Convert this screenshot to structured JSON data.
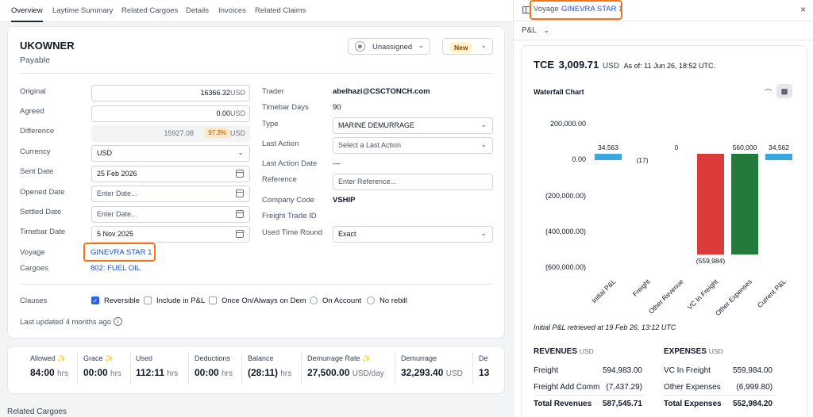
{
  "tabs": [
    "Overview",
    "Laytime Summary",
    "Related Cargoes",
    "Details",
    "Invoices",
    "Related Claims"
  ],
  "header": {
    "title": "UKOWNER",
    "subtitle": "Payable",
    "assignee": "Unassigned",
    "status": "New"
  },
  "form_left": {
    "original_label": "Original",
    "original_value": "16366.32",
    "original_unit": "USD",
    "agreed_label": "Agreed",
    "agreed_value": "0.00",
    "agreed_unit": "USD",
    "difference_label": "Difference",
    "difference_value": "15927.08",
    "difference_pct": "97.3%",
    "difference_unit": "USD",
    "currency_label": "Currency",
    "currency_value": "USD",
    "sent_date_label": "Sent Date",
    "sent_date_value": "25 Feb 2026",
    "opened_date_label": "Opened Date",
    "opened_date_placeholder": "Enter Date...",
    "settled_date_label": "Settled Date",
    "settled_date_placeholder": "Enter Date...",
    "timebar_date_label": "Timebar Date",
    "timebar_date_value": "5 Nov 2025",
    "voyage_label": "Voyage",
    "voyage_value": "GINEVRA STAR 1",
    "cargoes_label": "Cargoes",
    "cargoes_value": "802: FUEL OIL"
  },
  "form_right": {
    "trader_label": "Trader",
    "trader_value": "abelhazi@CSCTONCH.com",
    "timebar_days_label": "Timebar Days",
    "timebar_days_value": "90",
    "type_label": "Type",
    "type_value": "MARINE DEMURRAGE",
    "last_action_label": "Last Action",
    "last_action_placeholder": "Select a Last Action",
    "last_action_date_label": "Last Action Date",
    "last_action_date_value": "—",
    "reference_label": "Reference",
    "reference_placeholder": "Enter Reference...",
    "company_code_label": "Company Code",
    "company_code_value": "VSHIP",
    "freight_trade_id_label": "Freight Trade ID",
    "used_time_round_label": "Used Time Round",
    "used_time_round_value": "Exact"
  },
  "clauses": {
    "label": "Clauses",
    "items": [
      "Reversible",
      "Include in P&L",
      "Once On/Always on Dem",
      "On Account",
      "No rebill"
    ],
    "last_updated": "Last updated 4 months ago"
  },
  "metrics": [
    {
      "label": "Allowed",
      "value": "84:00",
      "unit": "hrs",
      "icon": true
    },
    {
      "label": "Grace",
      "value": "00:00",
      "unit": "hrs",
      "icon": true
    },
    {
      "label": "Used",
      "value": "112:11",
      "unit": "hrs",
      "icon": false
    },
    {
      "label": "Deductions",
      "value": "00:00",
      "unit": "hrs",
      "icon": false
    },
    {
      "label": "Balance",
      "value": "(28:11)",
      "unit": "hrs",
      "icon": false
    },
    {
      "label": "Demurrage Rate",
      "value": "27,500.00",
      "unit": "USD/day",
      "icon": true
    },
    {
      "label": "Demurrage",
      "value": "32,293.40",
      "unit": "USD",
      "icon": false
    },
    {
      "label": "De",
      "value": "13",
      "unit": "",
      "icon": false
    }
  ],
  "related_cargoes_heading": "Related Cargoes",
  "right_panel": {
    "voyage_prefix": "Voyage",
    "voyage_name": "GINEVRA STAR 1",
    "pl_dropdown": "P&L",
    "tce_label": "TCE",
    "tce_value": "3,009.71",
    "tce_unit": "USD",
    "as_of": "As of: 11 Jun 26, 18:52 UTC.",
    "chart_title": "Waterfall Chart",
    "retrieved_note": "Initial P&L retrieved at 19 Feb 26, 13:12 UTC",
    "revenues_title": "REVENUES",
    "revenues_unit": "USD",
    "revenues": [
      {
        "label": "Freight",
        "value": "594,983.00"
      },
      {
        "label": "Freight Add Comm",
        "value": "(7,437.29)"
      }
    ],
    "total_revenues_label": "Total Revenues",
    "total_revenues_value": "587,545.71",
    "expenses_title": "EXPENSES",
    "expenses_unit": "USD",
    "expenses": [
      {
        "label": "VC In Freight",
        "value": "559,984.00"
      },
      {
        "label": "Other Expenses",
        "value": "(6,999.80)"
      }
    ],
    "total_expenses_label": "Total Expenses",
    "total_expenses_value": "552,984.20"
  },
  "chart_data": {
    "type": "bar",
    "title": "Waterfall Chart",
    "categories": [
      "Initial P&L",
      "Freight",
      "Other Revenue",
      "VC In Freight",
      "Other Expenses",
      "Current P&L"
    ],
    "y_ticks": [
      "200,000.00",
      "0.00",
      "(200,000.00)",
      "(400,000.00)",
      "(600,000.00)"
    ],
    "ylim": [
      -600000,
      200000
    ],
    "bars": [
      {
        "start": 0,
        "end": 34563,
        "label": "34,563",
        "color": "#3ba7e0"
      },
      {
        "start": 34563,
        "end": 34546,
        "label": "(17)",
        "color": "#3ba7e0"
      },
      {
        "start": 34546,
        "end": 34546,
        "label": "0",
        "color": "#3ba7e0"
      },
      {
        "start": 34546,
        "end": -525438,
        "label": "(559,984)",
        "color": "#dc3b3b"
      },
      {
        "start": -525438,
        "end": 34562,
        "label": "560,000",
        "color": "#237a3b"
      },
      {
        "start": 0,
        "end": 34562,
        "label": "34,562",
        "color": "#3ba7e0"
      }
    ]
  }
}
